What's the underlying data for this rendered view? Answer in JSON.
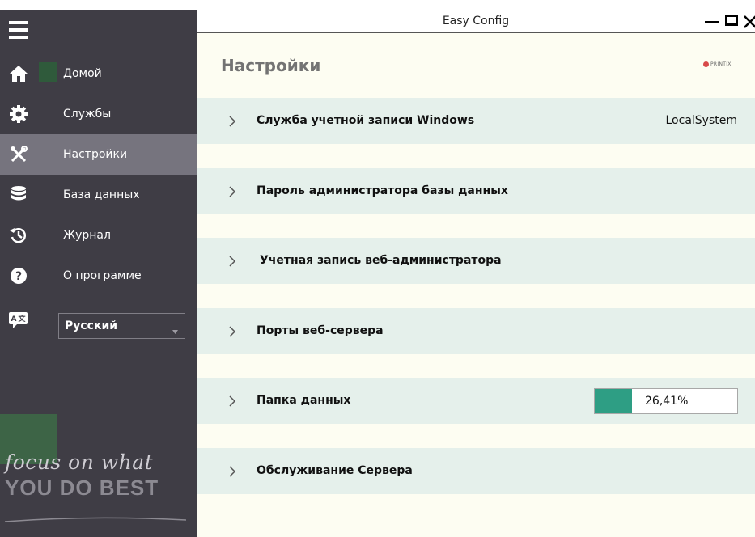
{
  "window": {
    "title": "Easy Config",
    "controls": [
      "minimize",
      "maximize",
      "close"
    ]
  },
  "sidebar": {
    "menu_icon": "hamburger-icon",
    "items": [
      {
        "label": "Домой",
        "icon": "home-icon",
        "active": false
      },
      {
        "label": "Службы",
        "icon": "gear-icon",
        "active": false
      },
      {
        "label": "Настройки",
        "icon": "tools-icon",
        "active": true
      },
      {
        "label": "База данных",
        "icon": "database-icon",
        "active": false
      },
      {
        "label": "Журнал",
        "icon": "history-icon",
        "active": false
      },
      {
        "label": "О программе",
        "icon": "help-icon",
        "active": false
      }
    ],
    "language": {
      "icon": "translate-icon",
      "selected": "Русский"
    },
    "tagline": {
      "line1": "focus on what",
      "line2": "YOU DO BEST"
    }
  },
  "main": {
    "title": "Настройки",
    "brand": "PRINTIX",
    "rows": [
      {
        "label": "Служба учетной записи Windows",
        "value": "LocalSystem"
      },
      {
        "label": "Пароль администратора базы данных",
        "value": ""
      },
      {
        "label": "Учетная запись веб-администратора",
        "value": ""
      },
      {
        "label": "Порты веб-сервера",
        "value": ""
      },
      {
        "label": "Папка данных",
        "progress_text": "26,41%",
        "progress": 0.2641
      },
      {
        "label": "Обслуживание Сервера",
        "value": ""
      }
    ]
  },
  "colors": {
    "sidebar_bg": "#3f3d45",
    "sidebar_active": "#76747e",
    "content_bg": "#fdfdf2",
    "row_bg": "#e5f0eb",
    "progress_fill": "#2e9e84"
  }
}
